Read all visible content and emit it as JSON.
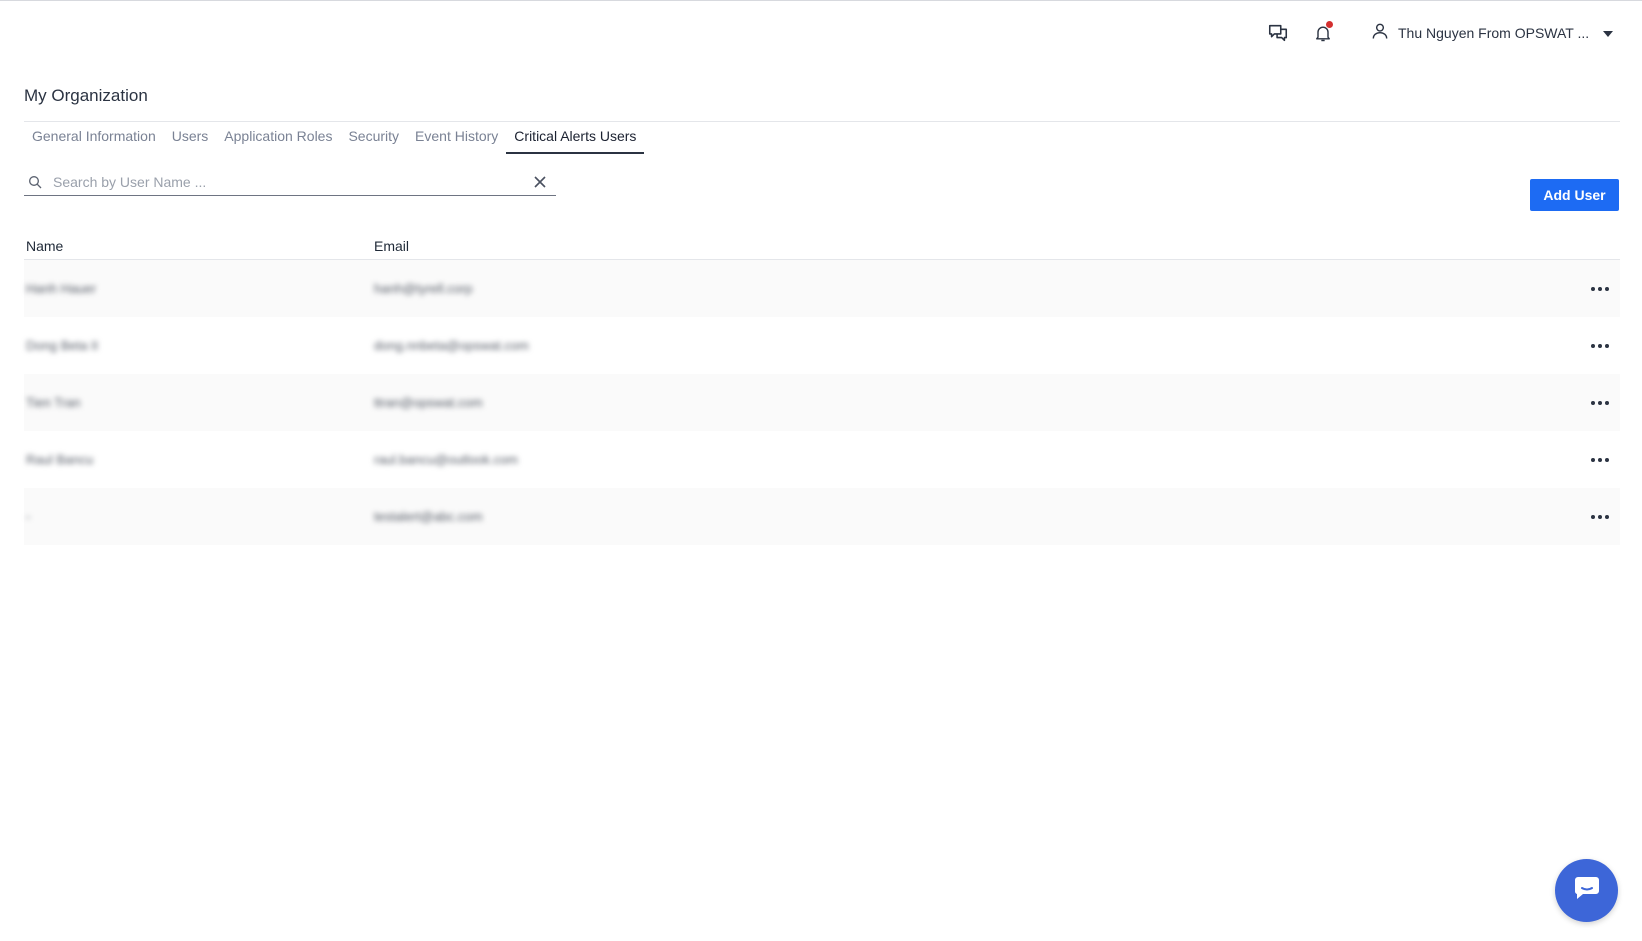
{
  "header": {
    "user_name": "Thu Nguyen From OPSWAT ...",
    "has_notification": true
  },
  "page": {
    "title": "My Organization"
  },
  "tabs": [
    {
      "label": "General Information",
      "active": false
    },
    {
      "label": "Users",
      "active": false
    },
    {
      "label": "Application Roles",
      "active": false
    },
    {
      "label": "Security",
      "active": false
    },
    {
      "label": "Event History",
      "active": false
    },
    {
      "label": "Critical Alerts Users",
      "active": true
    }
  ],
  "search": {
    "placeholder": "Search by User Name ...",
    "value": ""
  },
  "toolbar": {
    "add_user_label": "Add User"
  },
  "table": {
    "columns": [
      "Name",
      "Email"
    ],
    "rows": [
      {
        "name": "Hanh Hauer",
        "email": "hanh@tyrell.corp"
      },
      {
        "name": "Dong Beta II",
        "email": "dong.nnbeta@opswat.com"
      },
      {
        "name": "Tien Tran",
        "email": "ttran@opswat.com"
      },
      {
        "name": "Raul Bancu",
        "email": "raul.bancu@outlook.com"
      },
      {
        "name": "-",
        "email": "testalert@abc.com"
      }
    ]
  },
  "colors": {
    "accent": "#1d6bf3",
    "chat_fab": "#3d66d8",
    "notification_dot": "#d32f2f",
    "active_tab": "#2b3342"
  },
  "icons": {
    "chat": "chat-bubbles-icon",
    "notifications": "bell-icon",
    "user": "user-icon",
    "dropdown": "caret-down-icon",
    "search": "search-icon",
    "clear": "close-icon",
    "row_actions": "more-horizontal-icon",
    "support_chat": "chat-bubble-icon"
  }
}
